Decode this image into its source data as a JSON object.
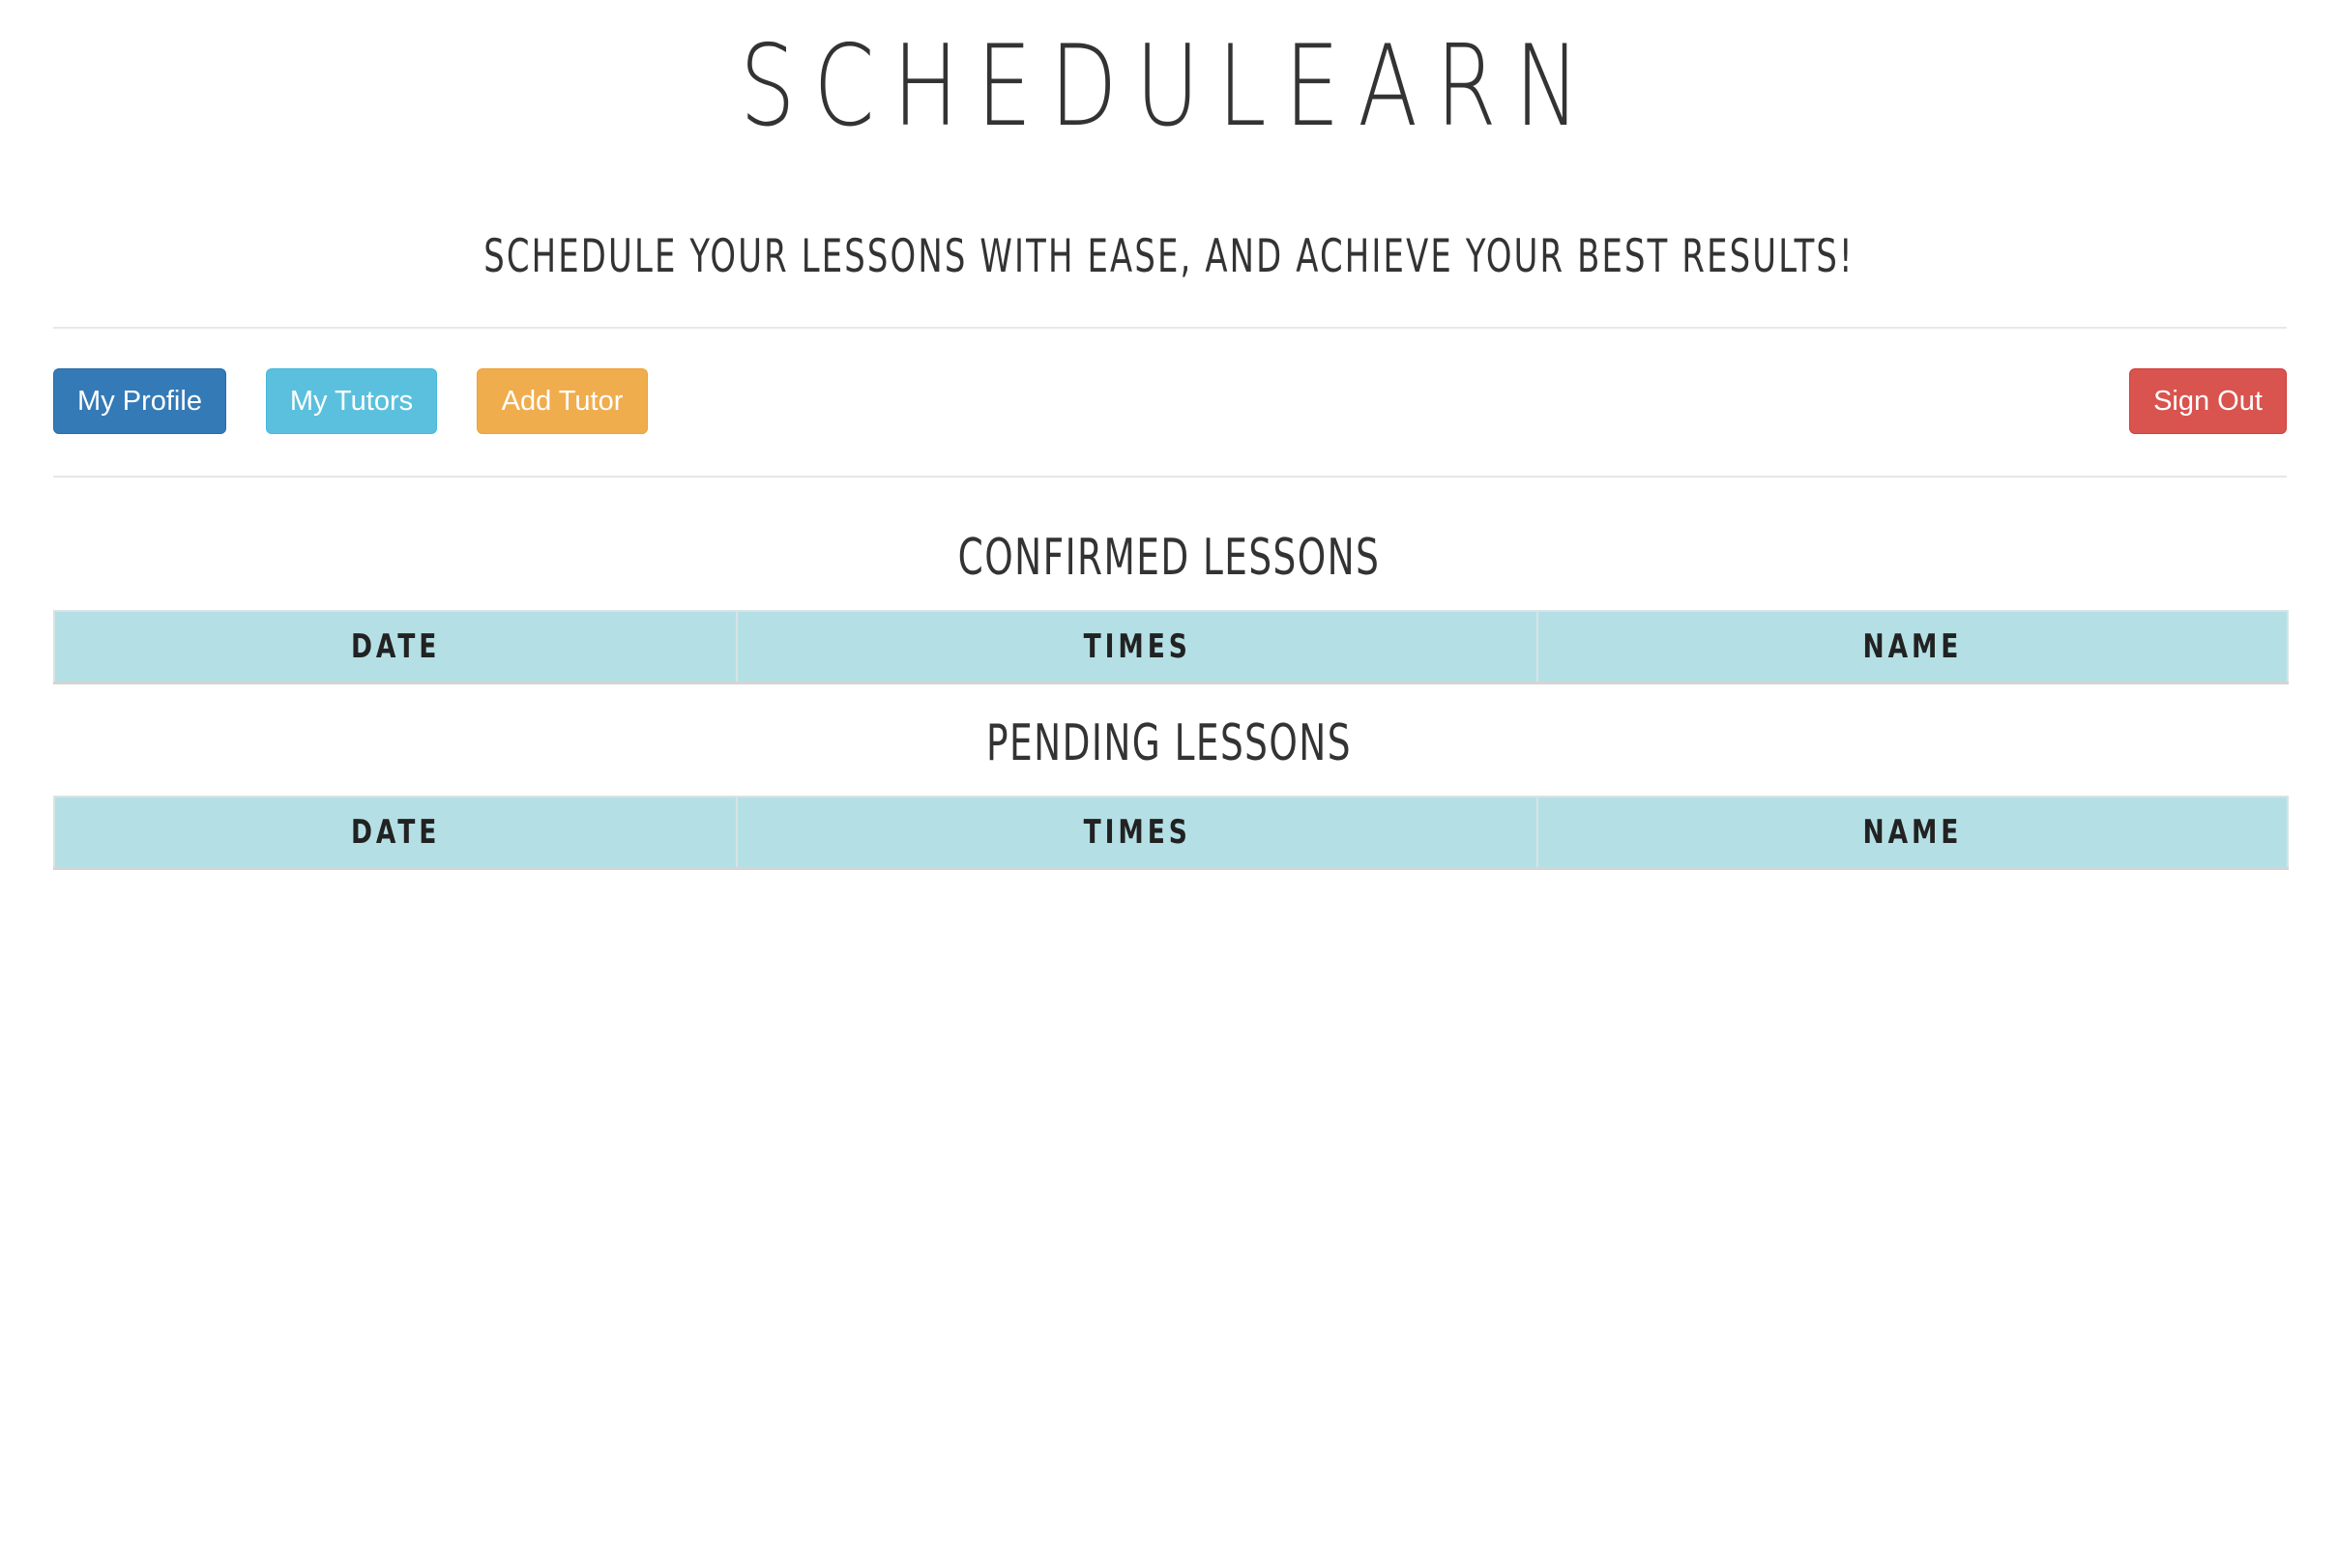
{
  "header": {
    "title": "SCHEDULEARN",
    "subtitle": "SCHEDULE YOUR LESSONS WITH EASE, AND ACHIEVE YOUR BEST RESULTS!"
  },
  "toolbar": {
    "profile_label": "My Profile",
    "tutors_label": "My Tutors",
    "add_tutor_label": "Add Tutor",
    "sign_out_label": "Sign Out"
  },
  "colors": {
    "profile_button": "#337ab7",
    "tutors_button": "#5bc0de",
    "add_tutor_button": "#f0ad4e",
    "sign_out_button": "#d9534f",
    "table_header": "#b4e0e5"
  },
  "confirmed": {
    "title": "CONFIRMED LESSONS",
    "columns": [
      "DATE",
      "TIMES",
      "NAME"
    ]
  },
  "pending": {
    "title": "PENDING LESSONS",
    "columns": [
      "DATE",
      "TIMES",
      "NAME"
    ]
  }
}
